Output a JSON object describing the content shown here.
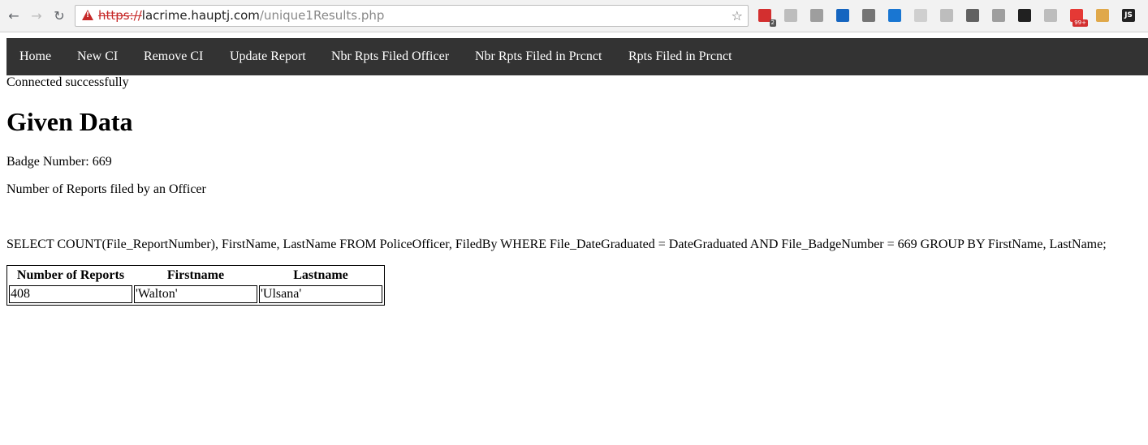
{
  "browser": {
    "url_scheme": "https://",
    "url_host": "lacrime.hauptj.com",
    "url_path": "/unique1Results.php",
    "extensions": [
      {
        "name": "ext-red-icon",
        "color": "#d32f2f",
        "badge": "2"
      },
      {
        "name": "ext-circle-icon",
        "color": "#bdbdbd"
      },
      {
        "name": "ext-search-icon",
        "color": "#9e9e9e"
      },
      {
        "name": "ext-flag-icon",
        "color": "#1565c0"
      },
      {
        "name": "ext-wordpress-icon",
        "color": "#757575"
      },
      {
        "name": "ext-window-icon",
        "color": "#1976d2"
      },
      {
        "name": "ext-camera-icon",
        "color": "#cfcfcf"
      },
      {
        "name": "ext-image-icon",
        "color": "#bdbdbd"
      },
      {
        "name": "ext-list-icon",
        "color": "#616161"
      },
      {
        "name": "ext-k-icon",
        "color": "#9e9e9e"
      },
      {
        "name": "ext-color-wheel-icon",
        "color": "#212121"
      },
      {
        "name": "ext-code-icon",
        "color": "#bdbdbd"
      },
      {
        "name": "ext-red-c-icon",
        "color": "#e53935",
        "badge": "99+"
      },
      {
        "name": "ext-doge-icon",
        "color": "#e0a84a"
      },
      {
        "name": "ext-js-icon",
        "color": "#222222",
        "label": "JS"
      }
    ]
  },
  "nav": {
    "items": [
      "Home",
      "New CI",
      "Remove CI",
      "Update Report",
      "Nbr Rpts Filed Officer",
      "Nbr Rpts Filed in Prcnct",
      "Rpts Filed in Prcnct"
    ]
  },
  "status": "Connected successfully",
  "heading": "Given Data",
  "badge_line": "Badge Number: 669",
  "description": "Number of Reports filed by an Officer",
  "query": "SELECT COUNT(File_ReportNumber), FirstName, LastName FROM PoliceOfficer, FiledBy WHERE File_DateGraduated = DateGraduated AND File_BadgeNumber = 669 GROUP BY FirstName, LastName;",
  "table": {
    "headers": [
      "Number of Reports",
      "Firstname",
      "Lastname"
    ],
    "rows": [
      [
        "408",
        "'Walton'",
        "'Ulsana'"
      ]
    ]
  }
}
